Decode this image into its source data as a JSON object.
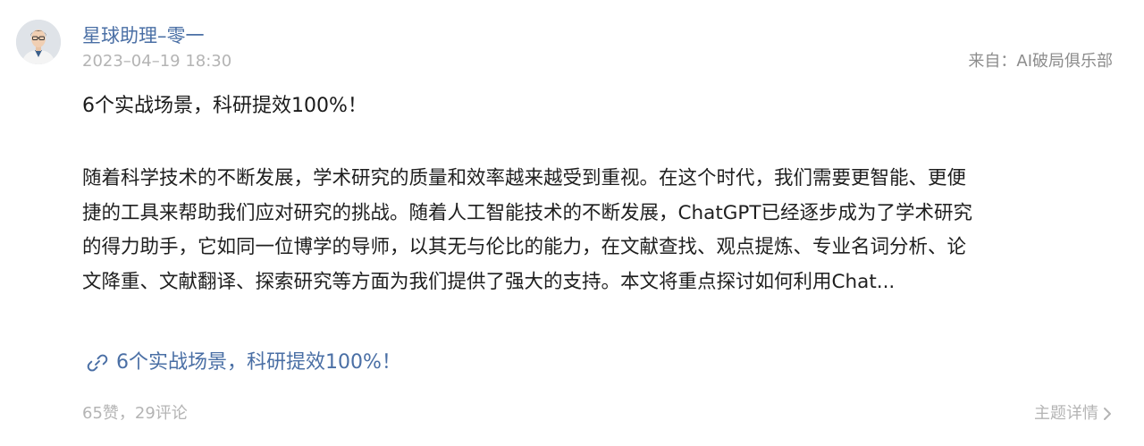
{
  "author": {
    "name": "星球助理–零一"
  },
  "post": {
    "time": "2023–04–19 18:30",
    "source": "来自：AI破局俱乐部",
    "title": "6个实战场景，科研提效100%！",
    "body_lines": [
      "随着科学技术的不断发展，学术研究的质量和效率越来越受到重视。在这个时代，我们需要更智能、更便",
      "捷的工具来帮助我们应对研究的挑战。随着人工智能技术的不断发展，ChatGPT已经逐步成为了学术研究",
      "的得力助手，它如同一位博学的导师，以其无与伦比的能力，在文献查找、观点提炼、专业名词分析、论",
      "文降重、文献翻译、探索研究等方面为我们提供了强大的支持。本文将重点探讨如何利用Chat..."
    ],
    "link_label": "6个实战场景，科研提效100%！",
    "stats": "65赞，29评论",
    "detail_label": "主题详情"
  },
  "icons": {
    "link": "link-icon",
    "chevron": "chevron-right-icon",
    "avatar": "avatar"
  },
  "colors": {
    "accent": "#4a6fa5",
    "muted": "#b4b4b4",
    "body_text": "#1f1f1f"
  }
}
